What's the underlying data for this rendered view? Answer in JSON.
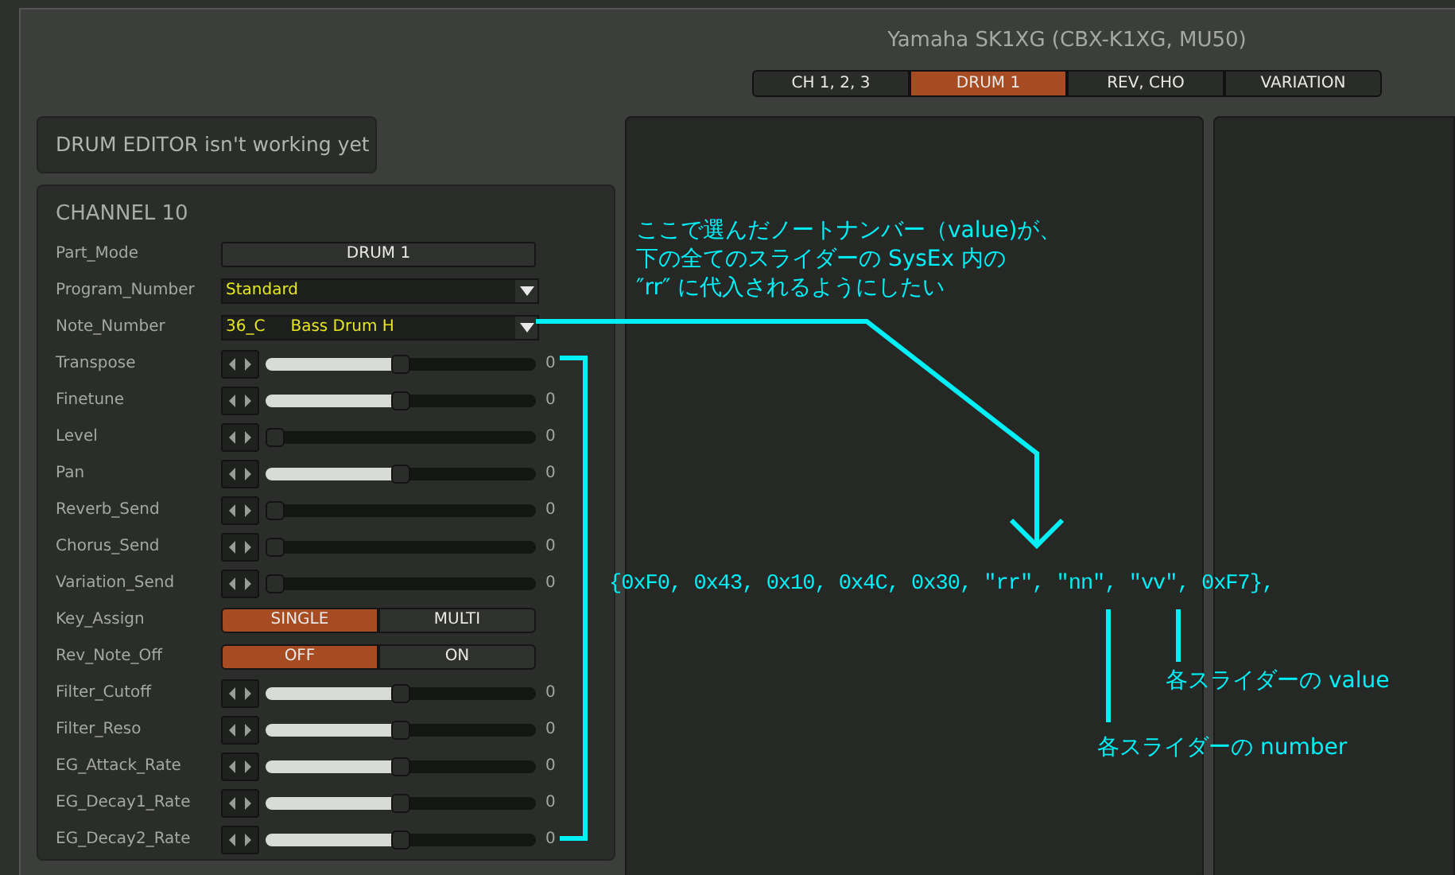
{
  "window": {
    "title": "Yamaha SK1XG (CBX-K1XG, MU50)"
  },
  "tabs": [
    {
      "label": "CH 1, 2, 3",
      "selected": false
    },
    {
      "label": "DRUM 1",
      "selected": true
    },
    {
      "label": "REV, CHO",
      "selected": false
    },
    {
      "label": "VARIATION",
      "selected": false
    }
  ],
  "notice": "DRUM EDITOR isn't working yet",
  "channel": {
    "title": "CHANNEL 10",
    "params": [
      {
        "kind": "button",
        "label": "Part_Mode",
        "value": "DRUM 1"
      },
      {
        "kind": "dropdown",
        "label": "Program_Number",
        "value": "Standard"
      },
      {
        "kind": "dropdown",
        "label": "Note_Number",
        "value": "36_C",
        "detail": "Bass Drum H"
      },
      {
        "kind": "slider",
        "label": "Transpose",
        "level": 0.5,
        "reading": "0"
      },
      {
        "kind": "slider",
        "label": "Finetune",
        "level": 0.5,
        "reading": "0"
      },
      {
        "kind": "slider",
        "label": "Level",
        "level": 0,
        "reading": "0"
      },
      {
        "kind": "slider",
        "label": "Pan",
        "level": 0.5,
        "reading": "0"
      },
      {
        "kind": "slider",
        "label": "Reverb_Send",
        "level": 0,
        "reading": "0"
      },
      {
        "kind": "slider",
        "label": "Chorus_Send",
        "level": 0,
        "reading": "0"
      },
      {
        "kind": "slider",
        "label": "Variation_Send",
        "level": 0,
        "reading": "0"
      },
      {
        "kind": "toggle",
        "label": "Key_Assign",
        "options": [
          {
            "label": "SINGLE",
            "selected": true
          },
          {
            "label": "MULTI",
            "selected": false
          }
        ]
      },
      {
        "kind": "toggle",
        "label": "Rev_Note_Off",
        "options": [
          {
            "label": "OFF",
            "selected": true
          },
          {
            "label": "ON",
            "selected": false
          }
        ]
      },
      {
        "kind": "slider",
        "label": "Filter_Cutoff",
        "level": 0.5,
        "reading": "0"
      },
      {
        "kind": "slider",
        "label": "Filter_Reso",
        "level": 0.5,
        "reading": "0"
      },
      {
        "kind": "slider",
        "label": "EG_Attack_Rate",
        "level": 0.5,
        "reading": "0"
      },
      {
        "kind": "slider",
        "label": "EG_Decay1_Rate",
        "level": 0.5,
        "reading": "0"
      },
      {
        "kind": "slider",
        "label": "EG_Decay2_Rate",
        "level": 0.5,
        "reading": "0"
      }
    ]
  },
  "annotations": {
    "note": [
      "ここで選んだノートナンバー（value)が、",
      "下の全てのスライダーの SysEx 内の",
      "″rr″ に代入されるようにしたい"
    ],
    "sysex": "{0xF0, 0x43, 0x10, 0x4C, 0x30, ″rr″, ″nn″, ″vv″, 0xF7},",
    "value_label": "各スライダーの value",
    "number_label": "各スライダーの number"
  }
}
